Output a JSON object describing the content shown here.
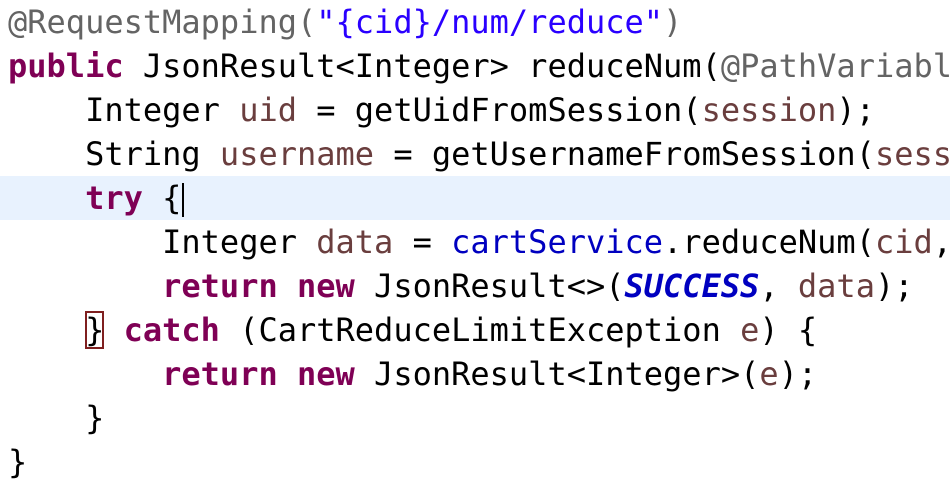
{
  "editor": {
    "lines": [
      {
        "tokens": [
          {
            "t": "@RequestMapping(",
            "c": "ann"
          },
          {
            "t": "\"{cid}/num/reduce\"",
            "c": "str"
          },
          {
            "t": ")",
            "c": "ann"
          }
        ]
      },
      {
        "tokens": [
          {
            "t": "public",
            "c": "kw"
          },
          {
            "t": " JsonResult<Integer> reduceNum(",
            "c": ""
          },
          {
            "t": "@PathVariabl",
            "c": "ann"
          }
        ]
      },
      {
        "tokens": [
          {
            "t": "    Integer ",
            "c": ""
          },
          {
            "t": "uid",
            "c": "var"
          },
          {
            "t": " = getUidFromSession(",
            "c": ""
          },
          {
            "t": "session",
            "c": "var"
          },
          {
            "t": ");",
            "c": ""
          }
        ]
      },
      {
        "tokens": [
          {
            "t": "    String ",
            "c": ""
          },
          {
            "t": "username",
            "c": "var"
          },
          {
            "t": " = getUsernameFromSession(",
            "c": ""
          },
          {
            "t": "sess",
            "c": "var"
          }
        ]
      },
      {
        "current": true,
        "tokens": [
          {
            "t": "    ",
            "c": ""
          },
          {
            "t": "try",
            "c": "kw"
          },
          {
            "t": " {",
            "c": ""
          },
          {
            "caret": true
          }
        ]
      },
      {
        "tokens": [
          {
            "t": "        Integer ",
            "c": ""
          },
          {
            "t": "data",
            "c": "var"
          },
          {
            "t": " = ",
            "c": ""
          },
          {
            "t": "cartService",
            "c": "field"
          },
          {
            "t": ".reduceNum(",
            "c": ""
          },
          {
            "t": "cid",
            "c": "var"
          },
          {
            "t": ",",
            "c": ""
          }
        ]
      },
      {
        "tokens": [
          {
            "t": "        ",
            "c": ""
          },
          {
            "t": "return",
            "c": "kw"
          },
          {
            "t": " ",
            "c": ""
          },
          {
            "t": "new",
            "c": "kw"
          },
          {
            "t": " JsonResult<>(",
            "c": ""
          },
          {
            "t": "SUCCESS",
            "c": "const"
          },
          {
            "t": ", ",
            "c": ""
          },
          {
            "t": "data",
            "c": "var"
          },
          {
            "t": ");",
            "c": ""
          }
        ]
      },
      {
        "tokens": [
          {
            "t": "    ",
            "c": ""
          },
          {
            "t": "}",
            "c": "boxed"
          },
          {
            "t": " ",
            "c": ""
          },
          {
            "t": "catch",
            "c": "kw"
          },
          {
            "t": " (CartReduceLimitException ",
            "c": ""
          },
          {
            "t": "e",
            "c": "var"
          },
          {
            "t": ") {",
            "c": ""
          }
        ]
      },
      {
        "tokens": [
          {
            "t": "        ",
            "c": ""
          },
          {
            "t": "return",
            "c": "kw"
          },
          {
            "t": " ",
            "c": ""
          },
          {
            "t": "new",
            "c": "kw"
          },
          {
            "t": " JsonResult<Integer>(",
            "c": ""
          },
          {
            "t": "e",
            "c": "var"
          },
          {
            "t": ");",
            "c": ""
          }
        ]
      },
      {
        "tokens": [
          {
            "t": "    }",
            "c": ""
          }
        ]
      },
      {
        "tokens": [
          {
            "t": "}",
            "c": ""
          }
        ]
      }
    ]
  }
}
